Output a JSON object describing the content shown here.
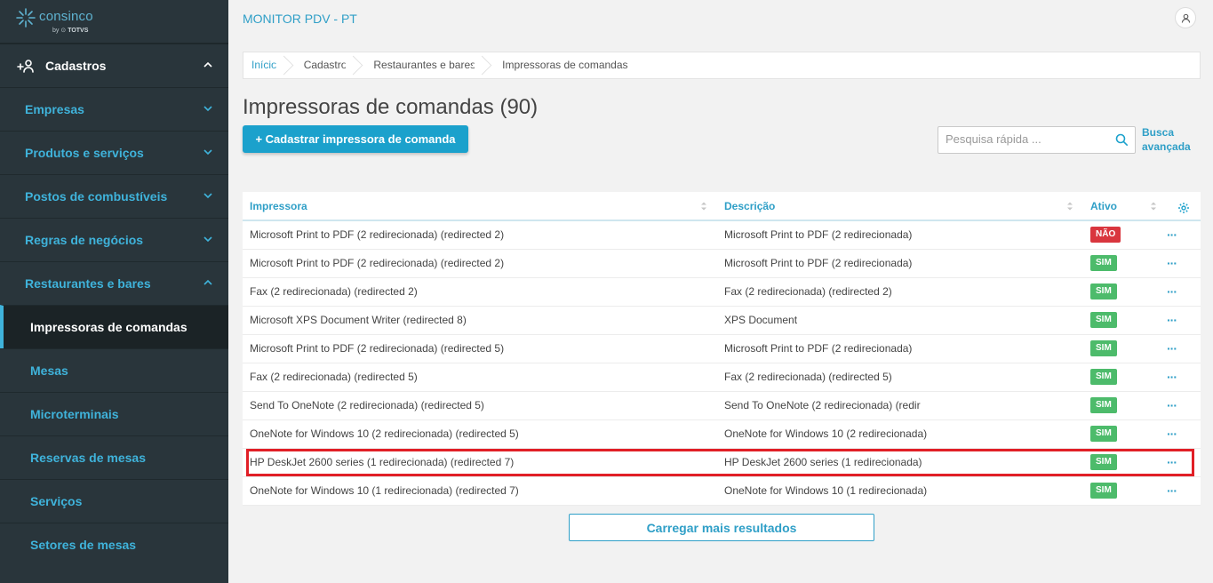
{
  "brand": {
    "name": "consinco",
    "by": "by",
    "vendor": "TOTVS"
  },
  "app_title": "MONITOR PDV - PT",
  "sidebar": {
    "header": {
      "label": "Cadastros"
    },
    "groups": [
      {
        "label": "Empresas"
      },
      {
        "label": "Produtos e serviços"
      },
      {
        "label": "Postos de combustíveis"
      },
      {
        "label": "Regras de negócios"
      },
      {
        "label": "Restaurantes e bares"
      }
    ],
    "subitems": [
      {
        "label": "Impressoras de comandas"
      },
      {
        "label": "Mesas"
      },
      {
        "label": "Microterminais"
      },
      {
        "label": "Reservas de mesas"
      },
      {
        "label": "Serviços"
      },
      {
        "label": "Setores de mesas"
      }
    ]
  },
  "breadcrumb": [
    "Início",
    "Cadastro",
    "Restaurantes e bares",
    "Impressoras de comandas"
  ],
  "page_title": "Impressoras de comandas (90)",
  "add_button": "+ Cadastrar impressora de comanda",
  "search": {
    "placeholder": "Pesquisa rápida ...",
    "value": ""
  },
  "advanced_search": "Busca avançada",
  "table": {
    "columns": [
      "Impressora",
      "Descrição",
      "Ativo"
    ],
    "rows": [
      {
        "printer": "Microsoft Print to PDF (2 redirecionada) (redirected 2)",
        "description": "Microsoft Print to PDF (2 redirecionada)",
        "active": "NÃO"
      },
      {
        "printer": "Microsoft Print to PDF (2 redirecionada) (redirected 2)",
        "description": "Microsoft Print to PDF (2 redirecionada)",
        "active": "SIM"
      },
      {
        "printer": "Fax (2 redirecionada) (redirected 2)",
        "description": "Fax (2 redirecionada) (redirected 2)",
        "active": "SIM"
      },
      {
        "printer": "Microsoft XPS Document Writer (redirected 8)",
        "description": "XPS Document",
        "active": "SIM"
      },
      {
        "printer": "Microsoft Print to PDF (2 redirecionada) (redirected 5)",
        "description": "Microsoft Print to PDF (2 redirecionada)",
        "active": "SIM"
      },
      {
        "printer": "Fax (2 redirecionada) (redirected 5)",
        "description": "Fax (2 redirecionada) (redirected 5)",
        "active": "SIM"
      },
      {
        "printer": "Send To OneNote (2 redirecionada) (redirected 5)",
        "description": "Send To OneNote (2 redirecionada) (redir",
        "active": "SIM"
      },
      {
        "printer": "OneNote for Windows 10 (2 redirecionada) (redirected 5)",
        "description": "OneNote for Windows 10 (2 redirecionada)",
        "active": "SIM"
      },
      {
        "printer": "HP DeskJet 2600 series (1 redirecionada) (redirected 7)",
        "description": "HP DeskJet 2600 series (1 redirecionada)",
        "active": "SIM"
      },
      {
        "printer": "OneNote for Windows 10 (1 redirecionada) (redirected 7)",
        "description": "OneNote for Windows 10 (1 redirecionada)",
        "active": "SIM"
      }
    ],
    "row_actions": "···"
  },
  "load_more": "Carregar mais resultados",
  "colors": {
    "accent": "#1ba1cc",
    "sidebar_bg": "#29353b",
    "active_yes": "#4dbb6b",
    "active_no": "#d9363e",
    "highlight": "#e11f26"
  }
}
